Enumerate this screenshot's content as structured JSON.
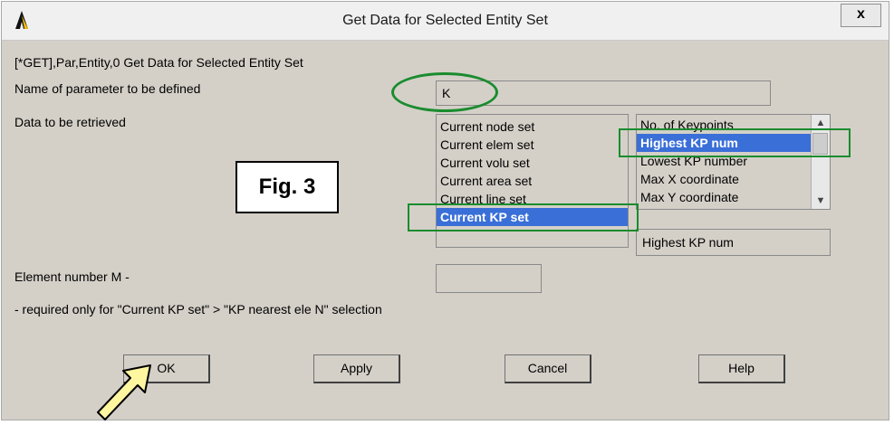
{
  "window": {
    "title": "Get Data for Selected Entity Set",
    "close_label": "x"
  },
  "command_label": "[*GET],Par,Entity,0  Get Data for Selected Entity Set",
  "param_name": {
    "label": "Name of parameter to be defined",
    "value": "K"
  },
  "data_retrieved": {
    "label": "Data to be retrieved",
    "entity_sets": [
      "Current node set",
      "Current elem set",
      "Current volu set",
      "Current area set",
      "Current line set",
      "Current KP set"
    ],
    "entity_selected": "Current KP set",
    "items": [
      "No. of Keypoints",
      "Highest KP num",
      "Lowest KP number",
      "Max X coordinate",
      "Max Y coordinate"
    ],
    "item_selected": "Highest KP num",
    "item_value": "Highest KP num"
  },
  "element_number": {
    "label": "Element number M -",
    "value": ""
  },
  "note": "- required only for \"Current KP set\" > \"KP nearest ele N\" selection",
  "buttons": {
    "ok": "OK",
    "apply": "Apply",
    "cancel": "Cancel",
    "help": "Help"
  },
  "annotation": {
    "fig_label": "Fig. 3"
  },
  "colors": {
    "highlight": "#3a6fd8",
    "annotation_green": "#1a8c2e",
    "arrow_fill": "#fff6a0"
  }
}
